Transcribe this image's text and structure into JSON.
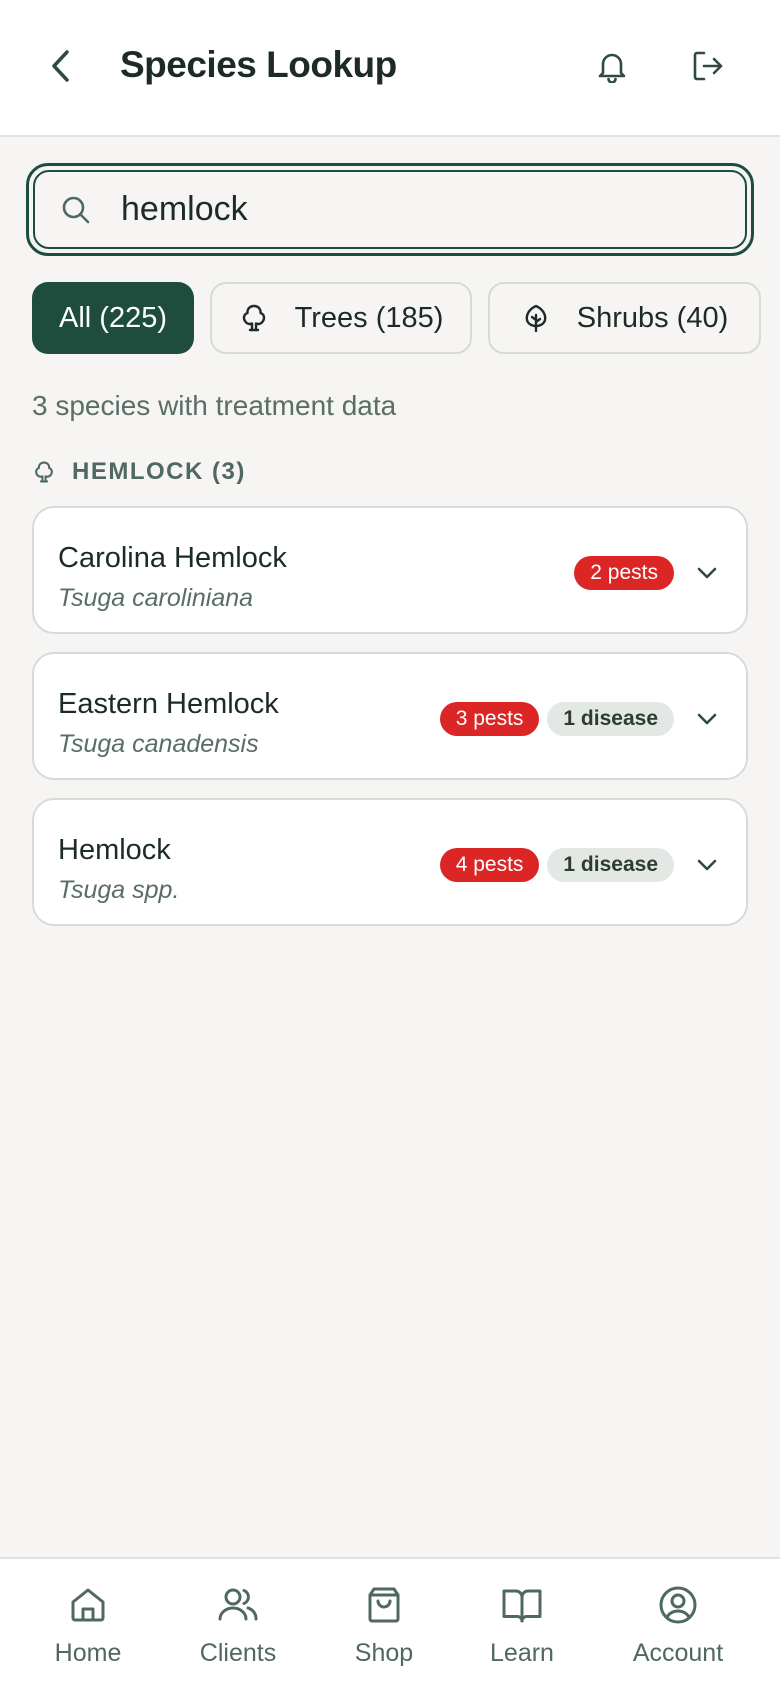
{
  "header": {
    "title": "Species Lookup",
    "back_icon": "chevron-left-icon",
    "notifications_icon": "bell-icon",
    "logout_icon": "logout-icon"
  },
  "search": {
    "value": "hemlock",
    "icon": "search-icon"
  },
  "filters": [
    {
      "label": "All (225)",
      "selected": true
    },
    {
      "label": "Trees (185)",
      "icon": "tree-icon",
      "selected": false
    },
    {
      "label": "Shrubs (40)",
      "icon": "shrub-icon",
      "selected": false
    }
  ],
  "result_summary": "3 species with treatment data",
  "group": {
    "title": "HEMLOCK (3)",
    "icon": "tree-icon"
  },
  "species": [
    {
      "name": "Carolina Hemlock",
      "scientific": "Tsuga caroliniana",
      "pests": "2 pests",
      "disease": ""
    },
    {
      "name": "Eastern Hemlock",
      "scientific": "Tsuga canadensis",
      "pests": "3 pests",
      "disease": "1 disease"
    },
    {
      "name": "Hemlock",
      "scientific": "Tsuga spp.",
      "pests": "4 pests",
      "disease": "1 disease"
    }
  ],
  "nav": [
    {
      "label": "Home",
      "icon": "home-icon"
    },
    {
      "label": "Clients",
      "icon": "users-icon"
    },
    {
      "label": "Shop",
      "icon": "shopping-bag-icon"
    },
    {
      "label": "Learn",
      "icon": "book-icon"
    },
    {
      "label": "Account",
      "icon": "user-circle-icon"
    }
  ],
  "colors": {
    "primary": "#1f4d3d",
    "pest_badge": "#dc2626",
    "disease_badge": "#e3e8e4",
    "background": "#f6f5f3"
  }
}
